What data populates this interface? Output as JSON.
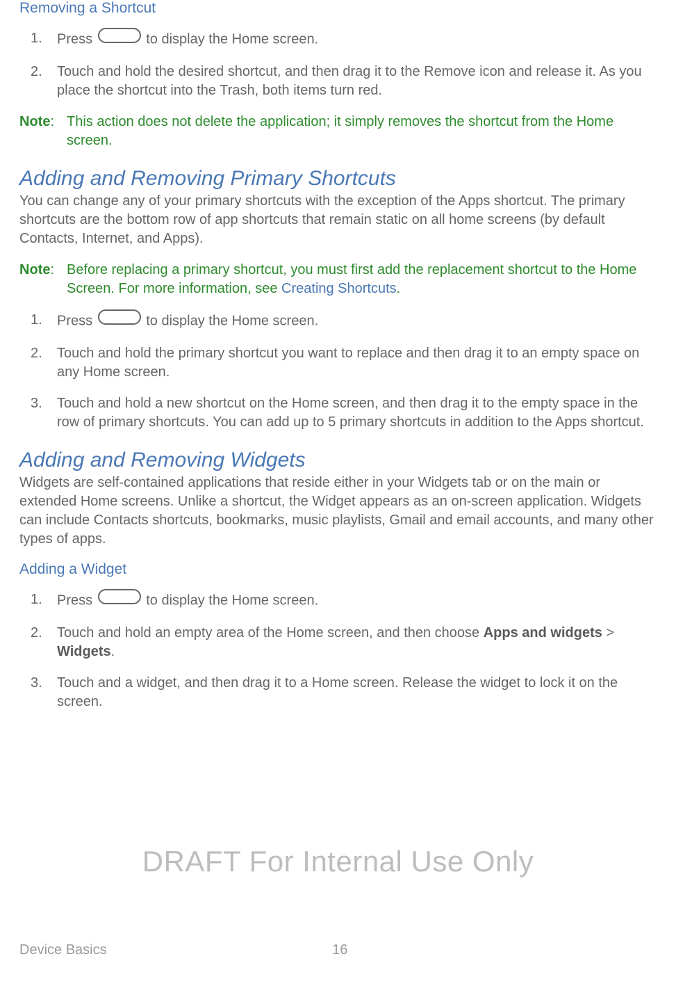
{
  "sec1": {
    "title": "Removing a Shortcut",
    "steps": [
      {
        "num": "1.",
        "pre": "Press ",
        "post": " to display the Home screen."
      },
      {
        "num": "2.",
        "text": "Touch and hold the desired shortcut, and then drag it to the Remove icon and release it. As you place the shortcut into the Trash, both items turn red."
      }
    ],
    "note_label": "Note",
    "note_body": "This action does not delete the application; it simply removes the shortcut from the Home screen."
  },
  "sec2": {
    "title": "Adding and Removing Primary Shortcuts",
    "intro": "You can change any of your primary shortcuts with the exception of the Apps shortcut. The primary shortcuts are the bottom row of app shortcuts that remain static on all home screens (by default Contacts, Internet, and Apps).",
    "note_label": "Note",
    "note_body_pre": "Before replacing a primary shortcut, you must first add the replacement shortcut to the Home Screen. For more information, see ",
    "note_link": "Creating Shortcuts",
    "note_body_post": ".",
    "steps": [
      {
        "num": "1.",
        "pre": "Press ",
        "post": " to display the Home screen."
      },
      {
        "num": "2.",
        "text": "Touch and hold the primary shortcut you want to replace and then drag it to an empty space on any Home screen."
      },
      {
        "num": "3.",
        "text": "Touch and hold a new shortcut on the Home screen, and then drag it to the empty space in the row of primary shortcuts. You can add up to 5 primary shortcuts in addition to the Apps shortcut."
      }
    ]
  },
  "sec3": {
    "title": "Adding and Removing Widgets",
    "intro": "Widgets are self-contained applications that reside either in your Widgets tab or on the main or extended Home screens. Unlike a shortcut, the Widget appears as an on-screen application. Widgets can include Contacts shortcuts, bookmarks, music playlists, Gmail and email accounts, and many other types of apps.",
    "sub": "Adding a Widget",
    "steps": [
      {
        "num": "1.",
        "pre": "Press ",
        "post": " to display the Home screen."
      },
      {
        "num": "2.",
        "pre": "Touch and hold an empty area of the Home screen, and then choose ",
        "b1": "Apps and widgets",
        "mid": " > ",
        "b2": "Widgets",
        "post2": "."
      },
      {
        "num": "3.",
        "text": "Touch and a widget, and then drag it to a Home screen. Release the widget to lock it on the screen."
      }
    ]
  },
  "watermark": "DRAFT For Internal Use Only",
  "footer": {
    "section": "Device Basics",
    "page": "16"
  }
}
